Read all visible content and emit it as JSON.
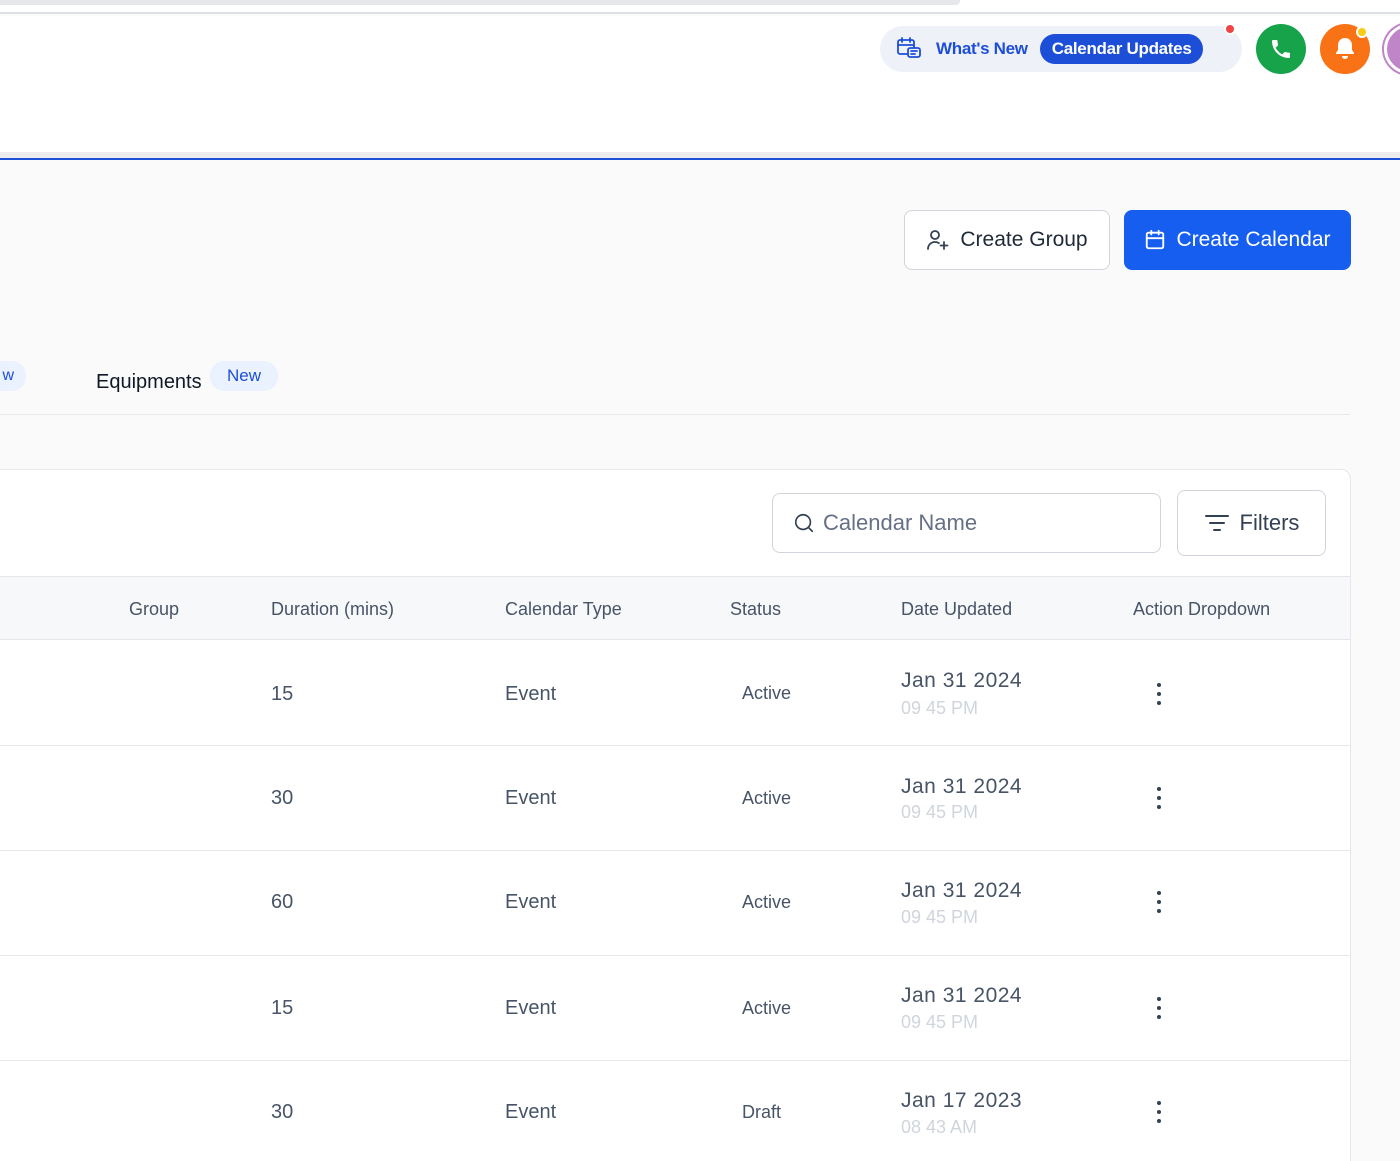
{
  "header": {
    "whats_new_label": "What's New",
    "whats_new_badge": "Calendar Updates",
    "phone_icon": "phone-icon",
    "bell_icon": "bell-icon"
  },
  "actions": {
    "create_group_label": "Create Group",
    "create_calendar_label": "Create Calendar"
  },
  "tabs": {
    "prev_badge": "w",
    "equipments_label": "Equipments",
    "equipments_badge": "New"
  },
  "toolbar": {
    "search_placeholder": "Calendar Name",
    "filters_label": "Filters"
  },
  "table": {
    "columns": [
      "Group",
      "Duration (mins)",
      "Calendar Type",
      "Status",
      "Date Updated",
      "Action Dropdown"
    ],
    "rows": [
      {
        "group": "",
        "duration": "15",
        "type": "Event",
        "status": "Active",
        "date": "Jan 31 2024",
        "time": "09 45 PM"
      },
      {
        "group": "",
        "duration": "30",
        "type": "Event",
        "status": "Active",
        "date": "Jan 31 2024",
        "time": "09 45 PM"
      },
      {
        "group": "",
        "duration": "60",
        "type": "Event",
        "status": "Active",
        "date": "Jan 31 2024",
        "time": "09 45 PM"
      },
      {
        "group": "",
        "duration": "15",
        "type": "Event",
        "status": "Active",
        "date": "Jan 31 2024",
        "time": "09 45 PM"
      },
      {
        "group": "",
        "duration": "30",
        "type": "Event",
        "status": "Draft",
        "date": "Jan 17 2023",
        "time": "08 43 AM"
      }
    ]
  },
  "colors": {
    "primary": "#155eef",
    "brand_text": "#1d4ed8",
    "phone": "#16a34a",
    "bell": "#f97316",
    "avatar": "#c084c8"
  }
}
